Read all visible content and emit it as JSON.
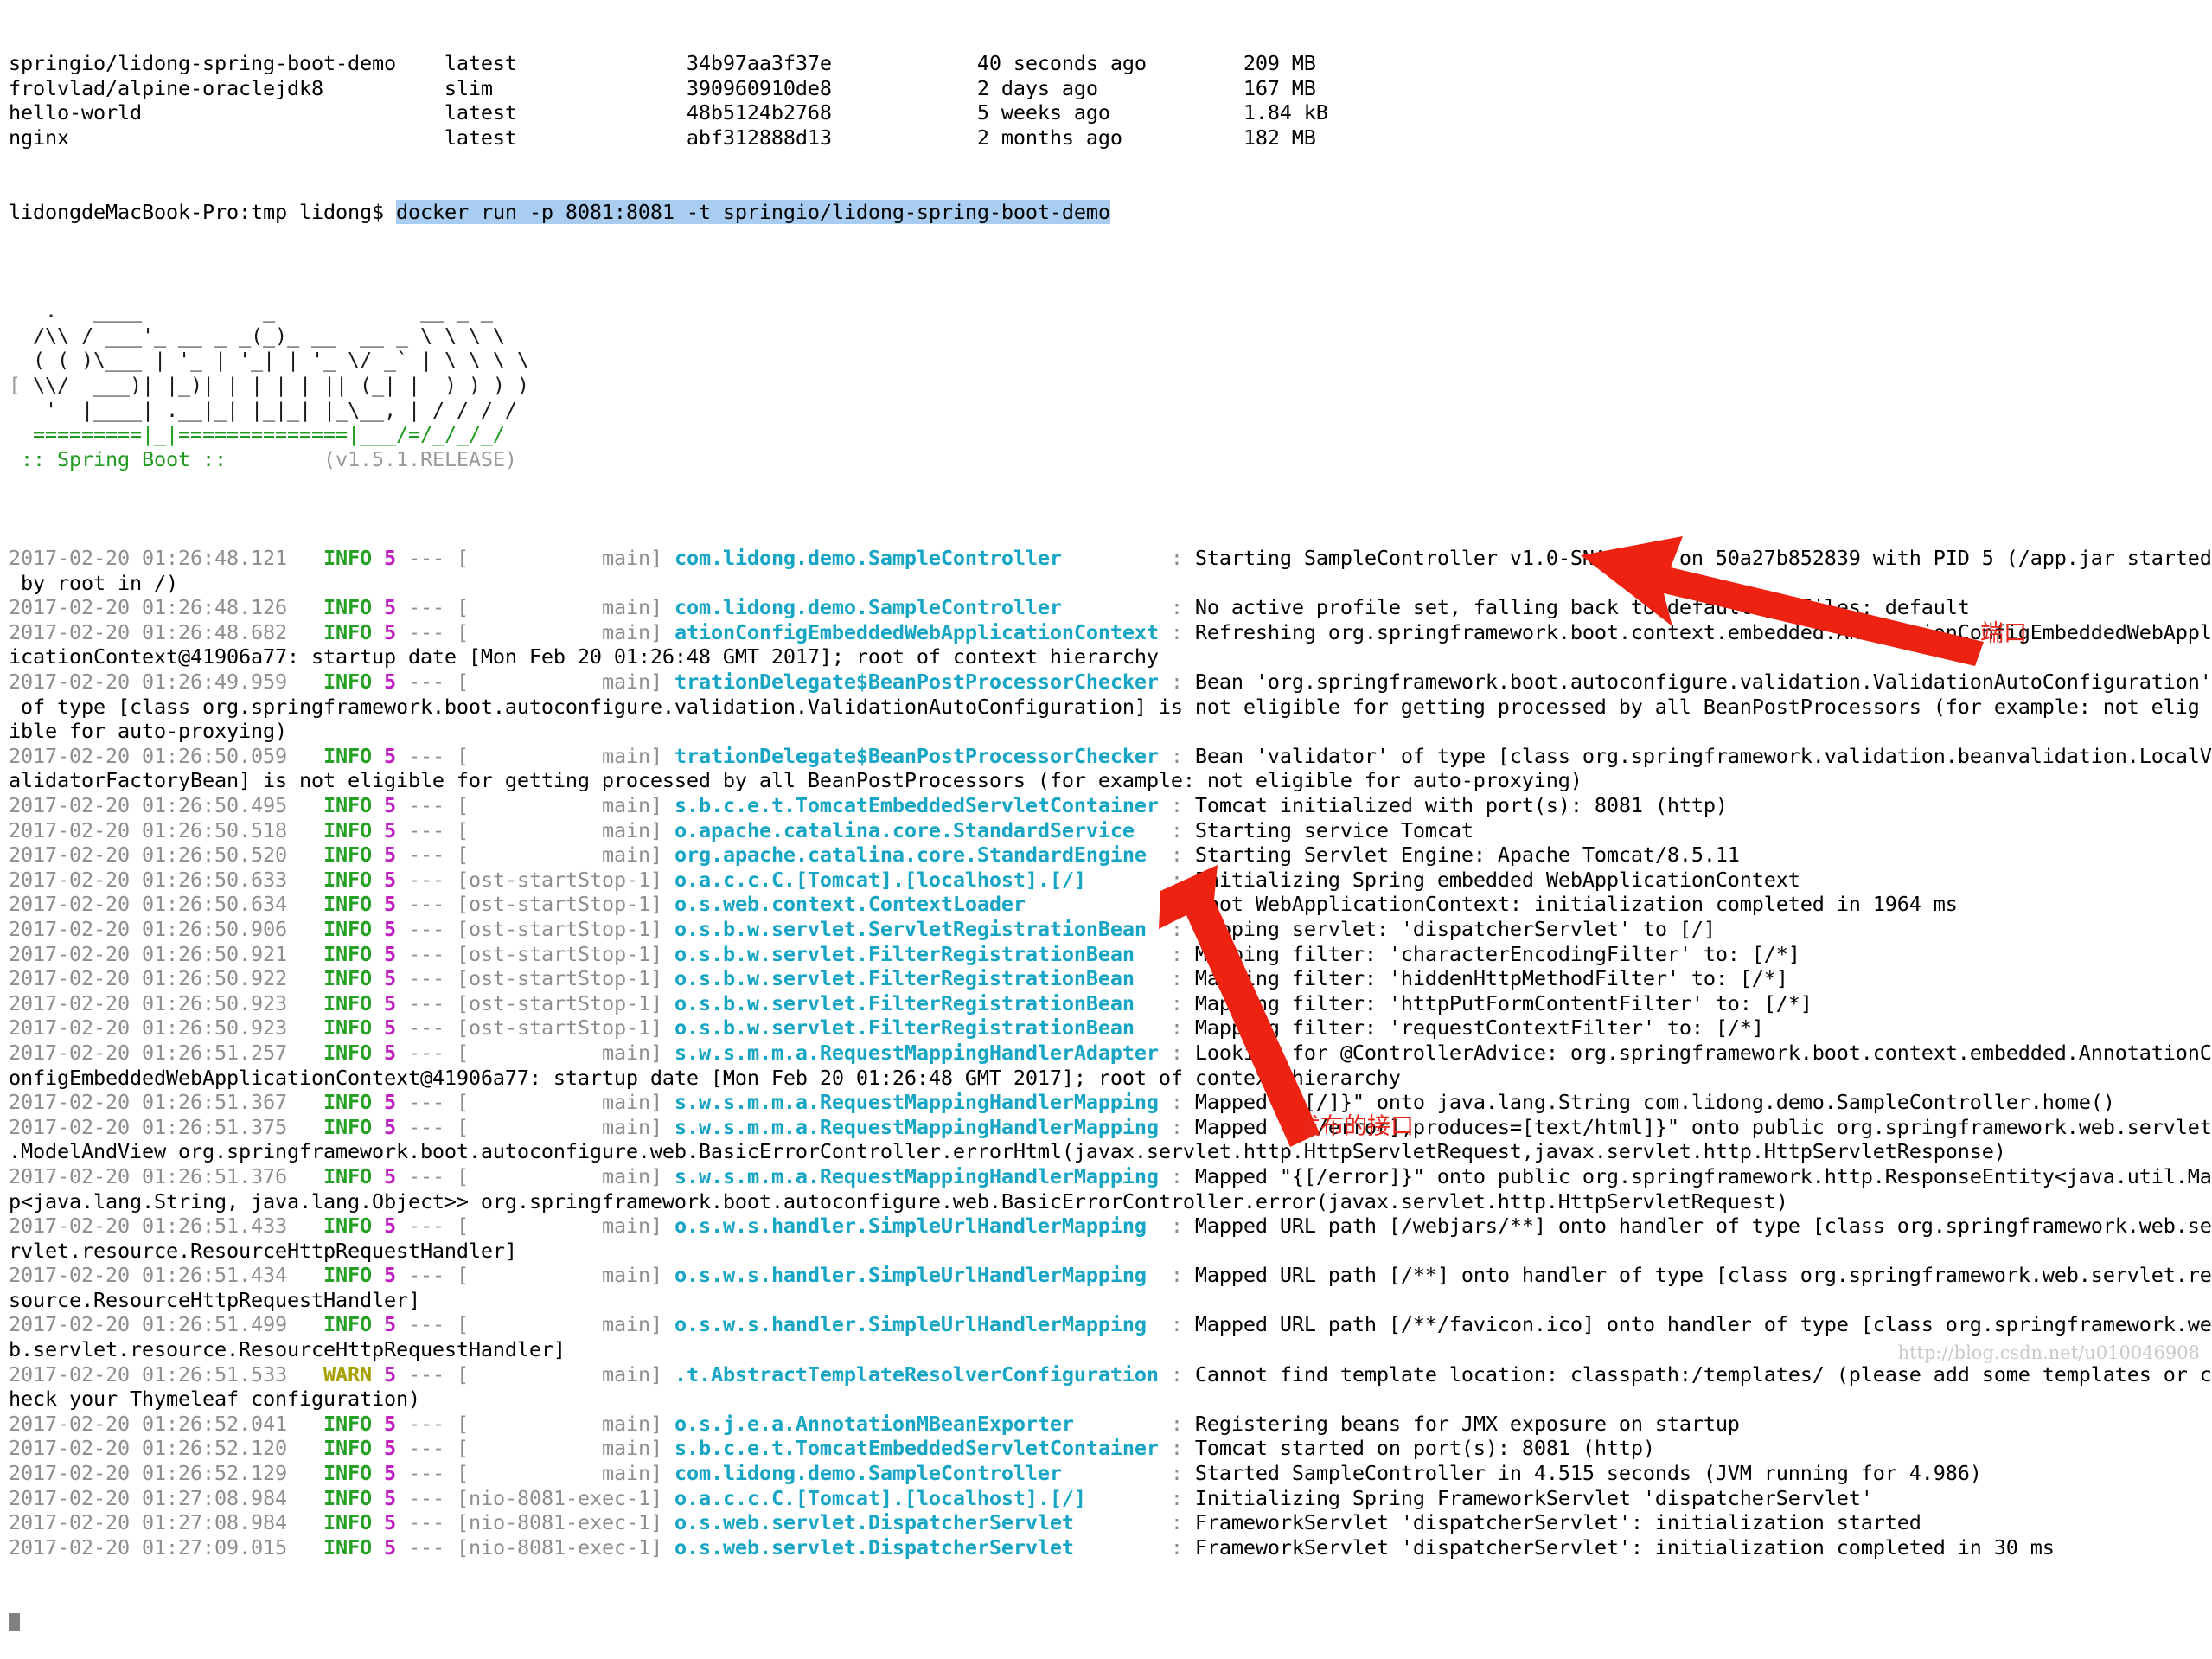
{
  "terminal": {
    "docker_images_header_shown": false,
    "docker_images": [
      {
        "repository": "springio/lidong-spring-boot-demo",
        "tag": "latest",
        "image_id": "34b97aa3f37e",
        "created": "40 seconds ago",
        "size": "209 MB"
      },
      {
        "repository": "frolvlad/alpine-oraclejdk8",
        "tag": "slim",
        "image_id": "390960910de8",
        "created": "2 days ago",
        "size": "167 MB"
      },
      {
        "repository": "hello-world",
        "tag": "latest",
        "image_id": "48b5124b2768",
        "created": "5 weeks ago",
        "size": "1.84 kB"
      },
      {
        "repository": "nginx",
        "tag": "latest",
        "image_id": "abf312888d13",
        "created": "2 months ago",
        "size": "182 MB"
      }
    ],
    "prompt": "lidongdeMacBook-Pro:tmp lidong$ ",
    "command": "docker run -p 8081:8081 -t springio/lidong-spring-boot-demo",
    "banner": {
      "lines": [
        "  .   ____          _            __ _ _",
        " /\\\\ / ___'_ __ _ _(_)_ __  __ _ \\ \\ \\ \\",
        "( ( )\\___ | '_ | '_| | '_ \\/ _` | \\ \\ \\ \\",
        " \\\\/  ___)| |_)| | | | | || (_| |  ) ) ) )",
        "  '  |____| .__|_| |_|_| |_\\__, | / / / /",
        " =========|_|==============|___/=/_/_/_/"
      ],
      "left_bracket": "[",
      "right_bracket": "]",
      "name": " :: Spring Boot :: ",
      "version": "       (v1.5.1.RELEASE)"
    },
    "log_lines": [
      {
        "type": "log",
        "ts": "2017-02-20 01:26:48.121",
        "level": "INFO",
        "pid": "5",
        "thread": "main",
        "cls": "com.lidong.demo.SampleController",
        "msg": "Starting SampleController v1.0-SNAPSHOT on 50a27b852839 with PID 5 (/app.jar started"
      },
      {
        "type": "cont",
        "text": " by root in /)"
      },
      {
        "type": "log",
        "ts": "2017-02-20 01:26:48.126",
        "level": "INFO",
        "pid": "5",
        "thread": "main",
        "cls": "com.lidong.demo.SampleController",
        "msg": "No active profile set, falling back to default profiles: default"
      },
      {
        "type": "log",
        "ts": "2017-02-20 01:26:48.682",
        "level": "INFO",
        "pid": "5",
        "thread": "main",
        "cls": "ationConfigEmbeddedWebApplicationContext",
        "msg": "Refreshing org.springframework.boot.context.embedded.AnnotationConfigEmbeddedWebAppl"
      },
      {
        "type": "cont",
        "text": "icationContext@41906a77: startup date [Mon Feb 20 01:26:48 GMT 2017]; root of context hierarchy"
      },
      {
        "type": "log",
        "ts": "2017-02-20 01:26:49.959",
        "level": "INFO",
        "pid": "5",
        "thread": "main",
        "cls": "trationDelegate$BeanPostProcessorChecker",
        "msg": "Bean 'org.springframework.boot.autoconfigure.validation.ValidationAutoConfiguration'"
      },
      {
        "type": "cont",
        "text": " of type [class org.springframework.boot.autoconfigure.validation.ValidationAutoConfiguration] is not eligible for getting processed by all BeanPostProcessors (for example: not elig"
      },
      {
        "type": "cont",
        "text": "ible for auto-proxying)"
      },
      {
        "type": "log",
        "ts": "2017-02-20 01:26:50.059",
        "level": "INFO",
        "pid": "5",
        "thread": "main",
        "cls": "trationDelegate$BeanPostProcessorChecker",
        "msg": "Bean 'validator' of type [class org.springframework.validation.beanvalidation.LocalV"
      },
      {
        "type": "cont",
        "text": "alidatorFactoryBean] is not eligible for getting processed by all BeanPostProcessors (for example: not eligible for auto-proxying)"
      },
      {
        "type": "log",
        "ts": "2017-02-20 01:26:50.495",
        "level": "INFO",
        "pid": "5",
        "thread": "main",
        "cls": "s.b.c.e.t.TomcatEmbeddedServletContainer",
        "msg": "Tomcat initialized with port(s): 8081 (http)"
      },
      {
        "type": "log",
        "ts": "2017-02-20 01:26:50.518",
        "level": "INFO",
        "pid": "5",
        "thread": "main",
        "cls": "o.apache.catalina.core.StandardService",
        "msg": "Starting service Tomcat"
      },
      {
        "type": "log",
        "ts": "2017-02-20 01:26:50.520",
        "level": "INFO",
        "pid": "5",
        "thread": "main",
        "cls": "org.apache.catalina.core.StandardEngine",
        "msg": "Starting Servlet Engine: Apache Tomcat/8.5.11"
      },
      {
        "type": "log",
        "ts": "2017-02-20 01:26:50.633",
        "level": "INFO",
        "pid": "5",
        "thread": "ost-startStop-1",
        "cls": "o.a.c.c.C.[Tomcat].[localhost].[/]",
        "msg": "Initializing Spring embedded WebApplicationContext"
      },
      {
        "type": "log",
        "ts": "2017-02-20 01:26:50.634",
        "level": "INFO",
        "pid": "5",
        "thread": "ost-startStop-1",
        "cls": "o.s.web.context.ContextLoader",
        "msg": "Root WebApplicationContext: initialization completed in 1964 ms"
      },
      {
        "type": "log",
        "ts": "2017-02-20 01:26:50.906",
        "level": "INFO",
        "pid": "5",
        "thread": "ost-startStop-1",
        "cls": "o.s.b.w.servlet.ServletRegistrationBean",
        "msg": "Mapping servlet: 'dispatcherServlet' to [/]"
      },
      {
        "type": "log",
        "ts": "2017-02-20 01:26:50.921",
        "level": "INFO",
        "pid": "5",
        "thread": "ost-startStop-1",
        "cls": "o.s.b.w.servlet.FilterRegistrationBean",
        "msg": "Mapping filter: 'characterEncodingFilter' to: [/*]"
      },
      {
        "type": "log",
        "ts": "2017-02-20 01:26:50.922",
        "level": "INFO",
        "pid": "5",
        "thread": "ost-startStop-1",
        "cls": "o.s.b.w.servlet.FilterRegistrationBean",
        "msg": "Mapping filter: 'hiddenHttpMethodFilter' to: [/*]"
      },
      {
        "type": "log",
        "ts": "2017-02-20 01:26:50.923",
        "level": "INFO",
        "pid": "5",
        "thread": "ost-startStop-1",
        "cls": "o.s.b.w.servlet.FilterRegistrationBean",
        "msg": "Mapping filter: 'httpPutFormContentFilter' to: [/*]"
      },
      {
        "type": "log",
        "ts": "2017-02-20 01:26:50.923",
        "level": "INFO",
        "pid": "5",
        "thread": "ost-startStop-1",
        "cls": "o.s.b.w.servlet.FilterRegistrationBean",
        "msg": "Mapping filter: 'requestContextFilter' to: [/*]"
      },
      {
        "type": "log",
        "ts": "2017-02-20 01:26:51.257",
        "level": "INFO",
        "pid": "5",
        "thread": "main",
        "cls": "s.w.s.m.m.a.RequestMappingHandlerAdapter",
        "msg": "Looking for @ControllerAdvice: org.springframework.boot.context.embedded.AnnotationC"
      },
      {
        "type": "cont",
        "text": "onfigEmbeddedWebApplicationContext@41906a77: startup date [Mon Feb 20 01:26:48 GMT 2017]; root of context hierarchy"
      },
      {
        "type": "log",
        "ts": "2017-02-20 01:26:51.367",
        "level": "INFO",
        "pid": "5",
        "thread": "main",
        "cls": "s.w.s.m.m.a.RequestMappingHandlerMapping",
        "msg": "Mapped \"{[/]}\" onto java.lang.String com.lidong.demo.SampleController.home()"
      },
      {
        "type": "log",
        "ts": "2017-02-20 01:26:51.375",
        "level": "INFO",
        "pid": "5",
        "thread": "main",
        "cls": "s.w.s.m.m.a.RequestMappingHandlerMapping",
        "msg": "Mapped \"{[/error],produces=[text/html]}\" onto public org.springframework.web.servlet"
      },
      {
        "type": "cont",
        "text": ".ModelAndView org.springframework.boot.autoconfigure.web.BasicErrorController.errorHtml(javax.servlet.http.HttpServletRequest,javax.servlet.http.HttpServletResponse)"
      },
      {
        "type": "log",
        "ts": "2017-02-20 01:26:51.376",
        "level": "INFO",
        "pid": "5",
        "thread": "main",
        "cls": "s.w.s.m.m.a.RequestMappingHandlerMapping",
        "msg": "Mapped \"{[/error]}\" onto public org.springframework.http.ResponseEntity<java.util.Ma"
      },
      {
        "type": "cont",
        "text": "p<java.lang.String, java.lang.Object>> org.springframework.boot.autoconfigure.web.BasicErrorController.error(javax.servlet.http.HttpServletRequest)"
      },
      {
        "type": "log",
        "ts": "2017-02-20 01:26:51.433",
        "level": "INFO",
        "pid": "5",
        "thread": "main",
        "cls": "o.s.w.s.handler.SimpleUrlHandlerMapping",
        "msg": "Mapped URL path [/webjars/**] onto handler of type [class org.springframework.web.se"
      },
      {
        "type": "cont",
        "text": "rvlet.resource.ResourceHttpRequestHandler]"
      },
      {
        "type": "log",
        "ts": "2017-02-20 01:26:51.434",
        "level": "INFO",
        "pid": "5",
        "thread": "main",
        "cls": "o.s.w.s.handler.SimpleUrlHandlerMapping",
        "msg": "Mapped URL path [/**] onto handler of type [class org.springframework.web.servlet.re"
      },
      {
        "type": "cont",
        "text": "source.ResourceHttpRequestHandler]"
      },
      {
        "type": "log",
        "ts": "2017-02-20 01:26:51.499",
        "level": "INFO",
        "pid": "5",
        "thread": "main",
        "cls": "o.s.w.s.handler.SimpleUrlHandlerMapping",
        "msg": "Mapped URL path [/**/favicon.ico] onto handler of type [class org.springframework.we"
      },
      {
        "type": "cont",
        "text": "b.servlet.resource.ResourceHttpRequestHandler]"
      },
      {
        "type": "log",
        "ts": "2017-02-20 01:26:51.533",
        "level": "WARN",
        "pid": "5",
        "thread": "main",
        "cls": ".t.AbstractTemplateResolverConfiguration",
        "msg": "Cannot find template location: classpath:/templates/ (please add some templates or c"
      },
      {
        "type": "cont",
        "text": "heck your Thymeleaf configuration)"
      },
      {
        "type": "log",
        "ts": "2017-02-20 01:26:52.041",
        "level": "INFO",
        "pid": "5",
        "thread": "main",
        "cls": "o.s.j.e.a.AnnotationMBeanExporter",
        "msg": "Registering beans for JMX exposure on startup"
      },
      {
        "type": "log",
        "ts": "2017-02-20 01:26:52.120",
        "level": "INFO",
        "pid": "5",
        "thread": "main",
        "cls": "s.b.c.e.t.TomcatEmbeddedServletContainer",
        "msg": "Tomcat started on port(s): 8081 (http)"
      },
      {
        "type": "log",
        "ts": "2017-02-20 01:26:52.129",
        "level": "INFO",
        "pid": "5",
        "thread": "main",
        "cls": "com.lidong.demo.SampleController",
        "msg": "Started SampleController in 4.515 seconds (JVM running for 4.986)"
      },
      {
        "type": "log",
        "ts": "2017-02-20 01:27:08.984",
        "level": "INFO",
        "pid": "5",
        "thread": "nio-8081-exec-1",
        "cls": "o.a.c.c.C.[Tomcat].[localhost].[/]",
        "msg": "Initializing Spring FrameworkServlet 'dispatcherServlet'"
      },
      {
        "type": "log",
        "ts": "2017-02-20 01:27:08.984",
        "level": "INFO",
        "pid": "5",
        "thread": "nio-8081-exec-1",
        "cls": "o.s.web.servlet.DispatcherServlet",
        "msg": "FrameworkServlet 'dispatcherServlet': initialization started"
      },
      {
        "type": "log",
        "ts": "2017-02-20 01:27:09.015",
        "level": "INFO",
        "pid": "5",
        "thread": "nio-8081-exec-1",
        "cls": "o.s.web.servlet.DispatcherServlet",
        "msg": "FrameworkServlet 'dispatcherServlet': initialization completed in 30 ms"
      }
    ]
  },
  "annotations": {
    "port_label": "端口",
    "api_label": "发布的接口",
    "arrow_color": "#ee2211",
    "label_color": "#e8261c"
  },
  "watermark": "http://blog.csdn.net/u010046908"
}
